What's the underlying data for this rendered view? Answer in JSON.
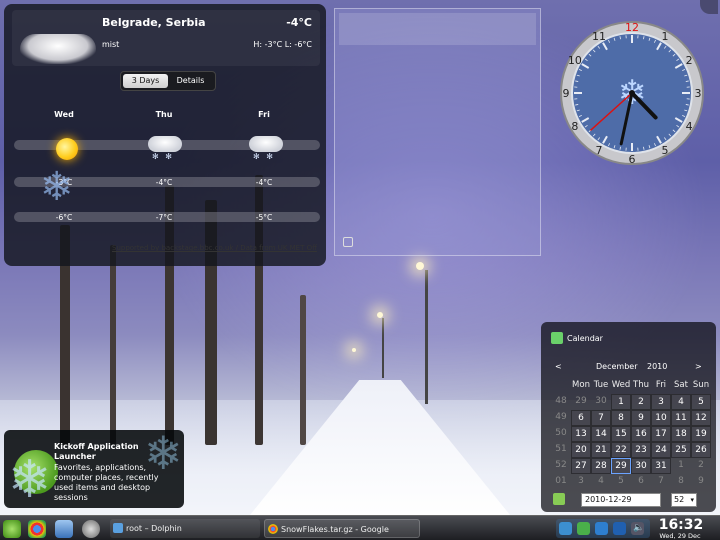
{
  "weather": {
    "city": "Belgrade, Serbia",
    "temp": "-4°C",
    "condition": "mist",
    "high_low": "H: -3°C L: -6°C",
    "tabs": [
      "3 Days",
      "Details"
    ],
    "active_tab": "3 Days",
    "days": [
      {
        "name": "Wed",
        "icon": "sun-icon",
        "high": "-3°C",
        "low": "-6°C"
      },
      {
        "name": "Thu",
        "icon": "snow-cloud-icon",
        "high": "-4°C",
        "low": "-7°C"
      },
      {
        "name": "Fri",
        "icon": "snow-cloud-icon",
        "high": "-4°C",
        "low": "-5°C"
      }
    ],
    "credit": "Supported by backstage.bbc.co.uk / Data from UK MET Off"
  },
  "clock": {
    "numbers": [
      "12",
      "1",
      "2",
      "3",
      "4",
      "5",
      "6",
      "7",
      "8",
      "9",
      "10",
      "11"
    ],
    "hour": 4,
    "minute": 32,
    "second": 38
  },
  "calendar": {
    "title": "Calendar",
    "month": "December",
    "year": "2010",
    "prev": "<",
    "next": ">",
    "weekdays": [
      "Mon",
      "Tue",
      "Wed",
      "Thu",
      "Fri",
      "Sat",
      "Sun"
    ],
    "weeks": [
      {
        "wk": "48",
        "days": [
          "29",
          "30",
          "1",
          "2",
          "3",
          "4",
          "5"
        ]
      },
      {
        "wk": "49",
        "days": [
          "6",
          "7",
          "8",
          "9",
          "10",
          "11",
          "12"
        ]
      },
      {
        "wk": "50",
        "days": [
          "13",
          "14",
          "15",
          "16",
          "17",
          "18",
          "19"
        ]
      },
      {
        "wk": "51",
        "days": [
          "20",
          "21",
          "22",
          "23",
          "24",
          "25",
          "26"
        ]
      },
      {
        "wk": "52",
        "days": [
          "27",
          "28",
          "29",
          "30",
          "31",
          "1",
          "2"
        ]
      },
      {
        "wk": "01",
        "days": [
          "3",
          "4",
          "5",
          "6",
          "7",
          "8",
          "9"
        ]
      }
    ],
    "date_value": "2010-12-29",
    "week_value": "52"
  },
  "kickoff": {
    "title": "Kickoff Application Launcher",
    "description": "Favorites, applications, computer places, recently used items and desktop sessions"
  },
  "taskbar": {
    "tasks": [
      "root – Dolphin",
      "SnowFlakes.tar.gz - Google Chrome"
    ],
    "time": "16:32",
    "date": "Wed, 29 Dec"
  }
}
